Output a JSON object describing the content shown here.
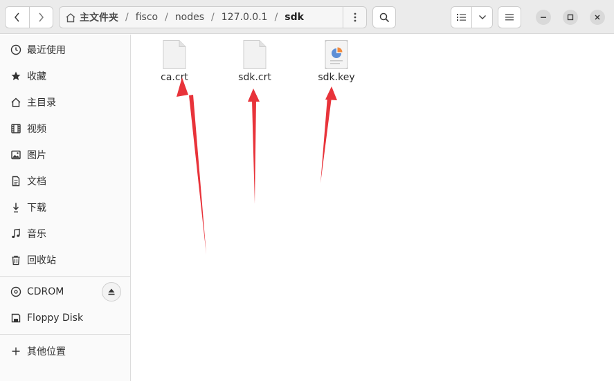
{
  "header": {
    "breadcrumbs": [
      {
        "label": "主文件夹"
      },
      {
        "label": "fisco"
      },
      {
        "label": "nodes"
      },
      {
        "label": "127.0.0.1"
      },
      {
        "label": "sdk"
      }
    ],
    "separator": "/",
    "icons": {
      "back": "chevron-left-icon",
      "forward": "chevron-right-icon",
      "home": "home-icon",
      "path_menu": "kebab-menu-icon",
      "search": "search-icon",
      "view_list": "list-view-icon",
      "view_options": "chevron-down-icon",
      "main_menu": "hamburger-menu-icon",
      "minimize": "minimize-icon",
      "maximize": "maximize-icon",
      "close": "close-icon"
    }
  },
  "sidebar": {
    "places": [
      {
        "label": "最近使用",
        "icon": "clock-icon"
      },
      {
        "label": "收藏",
        "icon": "star-icon"
      },
      {
        "label": "主目录",
        "icon": "home-icon"
      },
      {
        "label": "视频",
        "icon": "film-icon"
      },
      {
        "label": "图片",
        "icon": "image-icon"
      },
      {
        "label": "文档",
        "icon": "document-icon"
      },
      {
        "label": "下载",
        "icon": "download-icon"
      },
      {
        "label": "音乐",
        "icon": "music-note-icon"
      },
      {
        "label": "回收站",
        "icon": "trash-icon"
      }
    ],
    "devices": [
      {
        "label": "CDROM",
        "icon": "disc-icon",
        "action_icon": "eject-icon"
      },
      {
        "label": "Floppy Disk",
        "icon": "floppy-icon"
      }
    ],
    "other": {
      "label": "其他位置",
      "icon": "plus-icon"
    }
  },
  "files": [
    {
      "name": "ca.crt",
      "icon": "blank-file-icon"
    },
    {
      "name": "sdk.crt",
      "icon": "blank-file-icon"
    },
    {
      "name": "sdk.key",
      "icon": "key-file-icon"
    }
  ],
  "annotation": {
    "arrow_color": "#e8333a"
  },
  "colors": {
    "header_bg": "#ebebeb",
    "sidebar_bg": "#fafafa",
    "content_bg": "#ffffff"
  }
}
